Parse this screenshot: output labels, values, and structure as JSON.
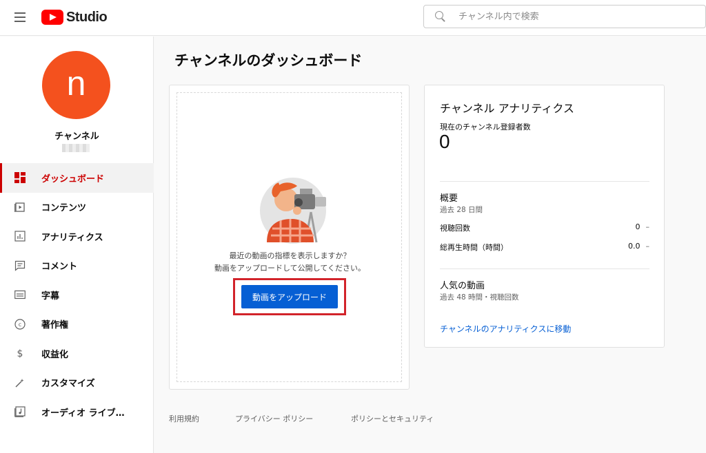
{
  "header": {
    "logo_text": "Studio",
    "search_placeholder": "チャンネル内で検索"
  },
  "sidebar": {
    "avatar_letter": "n",
    "channel_name": "チャンネル",
    "items": [
      {
        "label": "ダッシュボード",
        "icon": "dashboard-icon",
        "active": true
      },
      {
        "label": "コンテンツ",
        "icon": "content-icon"
      },
      {
        "label": "アナリティクス",
        "icon": "analytics-icon"
      },
      {
        "label": "コメント",
        "icon": "comments-icon"
      },
      {
        "label": "字幕",
        "icon": "subtitles-icon"
      },
      {
        "label": "著作権",
        "icon": "copyright-icon"
      },
      {
        "label": "収益化",
        "icon": "monetization-icon"
      },
      {
        "label": "カスタマイズ",
        "icon": "customize-icon"
      },
      {
        "label": "オーディオ ライブ…",
        "icon": "audio-library-icon"
      }
    ]
  },
  "main": {
    "page_title": "チャンネルのダッシュボード",
    "upload_card": {
      "line1": "最近の動画の指標を表示しますか？",
      "line2": "動画をアップロードして公開してください。",
      "button_label": "動画をアップロード"
    },
    "analytics": {
      "title": "チャンネル アナリティクス",
      "subscribers_label": "現在のチャンネル登録者数",
      "subscribers_value": "0",
      "summary_title": "概要",
      "summary_period": "過去 28 日間",
      "views_label": "視聴回数",
      "views_value": "0",
      "watch_time_label": "総再生時間（時間）",
      "watch_time_value": "0.0",
      "dash": "–",
      "top_videos_title": "人気の動画",
      "top_videos_period": "過去 48 時間・視聴回数",
      "link_label": "チャンネルのアナリティクスに移動"
    }
  },
  "footer": {
    "terms": "利用規約",
    "privacy": "プライバシー ポリシー",
    "policy": "ポリシーとセキュリティ"
  },
  "colors": {
    "accent_red": "#cc0000",
    "button_blue": "#065fd4",
    "avatar_orange": "#f4511e",
    "highlight_red": "#d2232a"
  }
}
